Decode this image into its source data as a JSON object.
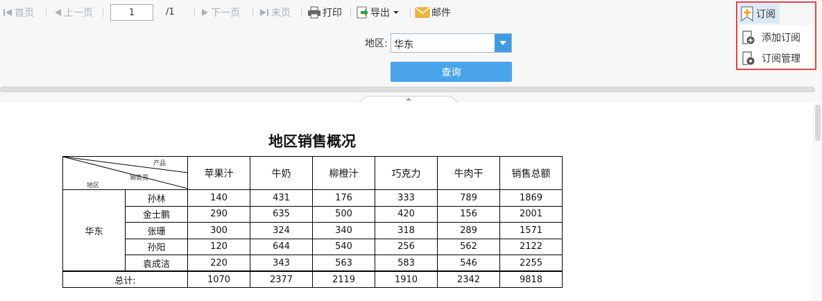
{
  "toolbar": {
    "first_page": "首页",
    "prev_page": "上一页",
    "current_page": "1",
    "page_total": "/1",
    "next_page": "下一页",
    "last_page": "末页",
    "print": "打印",
    "export": "导出",
    "mail": "邮件",
    "subscribe": "订阅"
  },
  "subscribe_menu": {
    "add": "添加订阅",
    "manage": "订阅管理"
  },
  "params": {
    "region_label": "地区:",
    "region_value": "华东",
    "query_button": "查询"
  },
  "report": {
    "title": "地区销售概况",
    "corner": {
      "product": "产品",
      "salesperson": "销售员",
      "region": "地区"
    },
    "columns": [
      "苹果汁",
      "牛奶",
      "柳橙汁",
      "巧克力",
      "牛肉干",
      "销售总额"
    ],
    "region": "华东",
    "rows": [
      {
        "name": "孙林",
        "values": [
          "140",
          "431",
          "176",
          "333",
          "789",
          "1869"
        ]
      },
      {
        "name": "金士鹏",
        "values": [
          "290",
          "635",
          "500",
          "420",
          "156",
          "2001"
        ]
      },
      {
        "name": "张珊",
        "values": [
          "300",
          "324",
          "340",
          "318",
          "289",
          "1571"
        ]
      },
      {
        "name": "孙阳",
        "values": [
          "120",
          "644",
          "540",
          "256",
          "562",
          "2122"
        ]
      },
      {
        "name": "袁成洁",
        "values": [
          "220",
          "343",
          "563",
          "583",
          "546",
          "2255"
        ]
      }
    ],
    "total_label": "总计:",
    "totals": [
      "1070",
      "2377",
      "2119",
      "1910",
      "2342",
      "9818"
    ]
  },
  "colors": {
    "accent_blue": "#4aa4eb",
    "highlight_red": "#e3424a",
    "disabled_gray": "#a9b2bd"
  }
}
